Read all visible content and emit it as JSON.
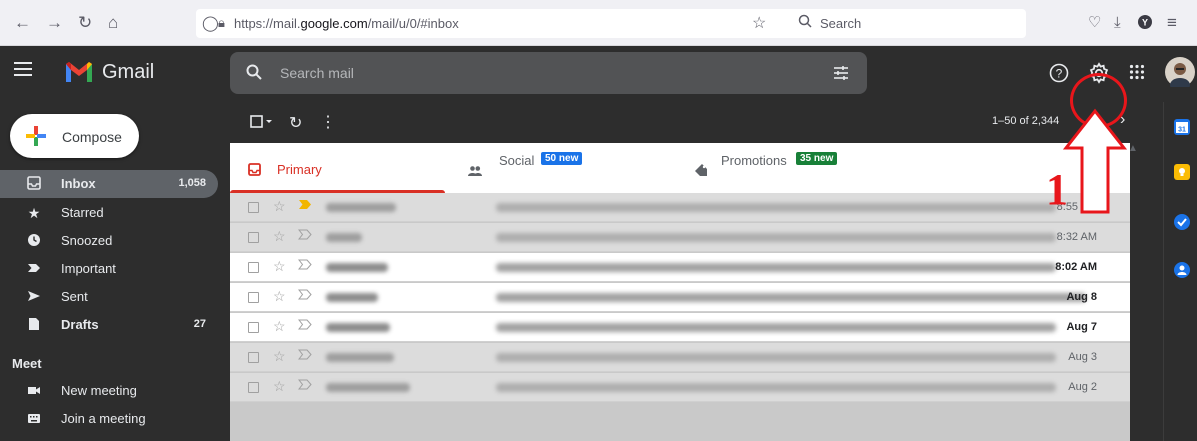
{
  "browser": {
    "url_prefix": "https://mail.",
    "url_domain": "google.com",
    "url_path": "/mail/u/0/#inbox",
    "search_label": "Search"
  },
  "header": {
    "app_name": "Gmail",
    "search_placeholder": "Search mail"
  },
  "sidebar": {
    "compose_label": "Compose",
    "items": [
      {
        "label": "Inbox",
        "count": "1,058",
        "icon": "inbox-icon"
      },
      {
        "label": "Starred",
        "count": "",
        "icon": "star-icon"
      },
      {
        "label": "Snoozed",
        "count": "",
        "icon": "clock-icon"
      },
      {
        "label": "Important",
        "count": "",
        "icon": "important-icon"
      },
      {
        "label": "Sent",
        "count": "",
        "icon": "send-icon"
      },
      {
        "label": "Drafts",
        "count": "27",
        "icon": "draft-icon"
      }
    ],
    "meet_heading": "Meet",
    "meet_items": [
      {
        "label": "New meeting",
        "icon": "video-icon"
      },
      {
        "label": "Join a meeting",
        "icon": "keyboard-icon"
      }
    ]
  },
  "toolbar": {
    "pagination": "1–50 of 2,344"
  },
  "tabs": [
    {
      "label": "Primary",
      "badge": ""
    },
    {
      "label": "Social",
      "badge": "50 new",
      "badge_color": "#1a73e8"
    },
    {
      "label": "Promotions",
      "badge": "35 new",
      "badge_color": "#188038"
    }
  ],
  "emails": [
    {
      "time": "8:55 AM",
      "unread": false
    },
    {
      "time": "8:32 AM",
      "unread": false
    },
    {
      "time": "8:02 AM",
      "unread": true
    },
    {
      "time": "Aug 8",
      "unread": true
    },
    {
      "time": "Aug 7",
      "unread": true
    },
    {
      "time": "Aug 3",
      "unread": false
    },
    {
      "time": "Aug 2",
      "unread": false
    }
  ],
  "annotation": {
    "number": "1",
    "color": "#e8161b"
  }
}
